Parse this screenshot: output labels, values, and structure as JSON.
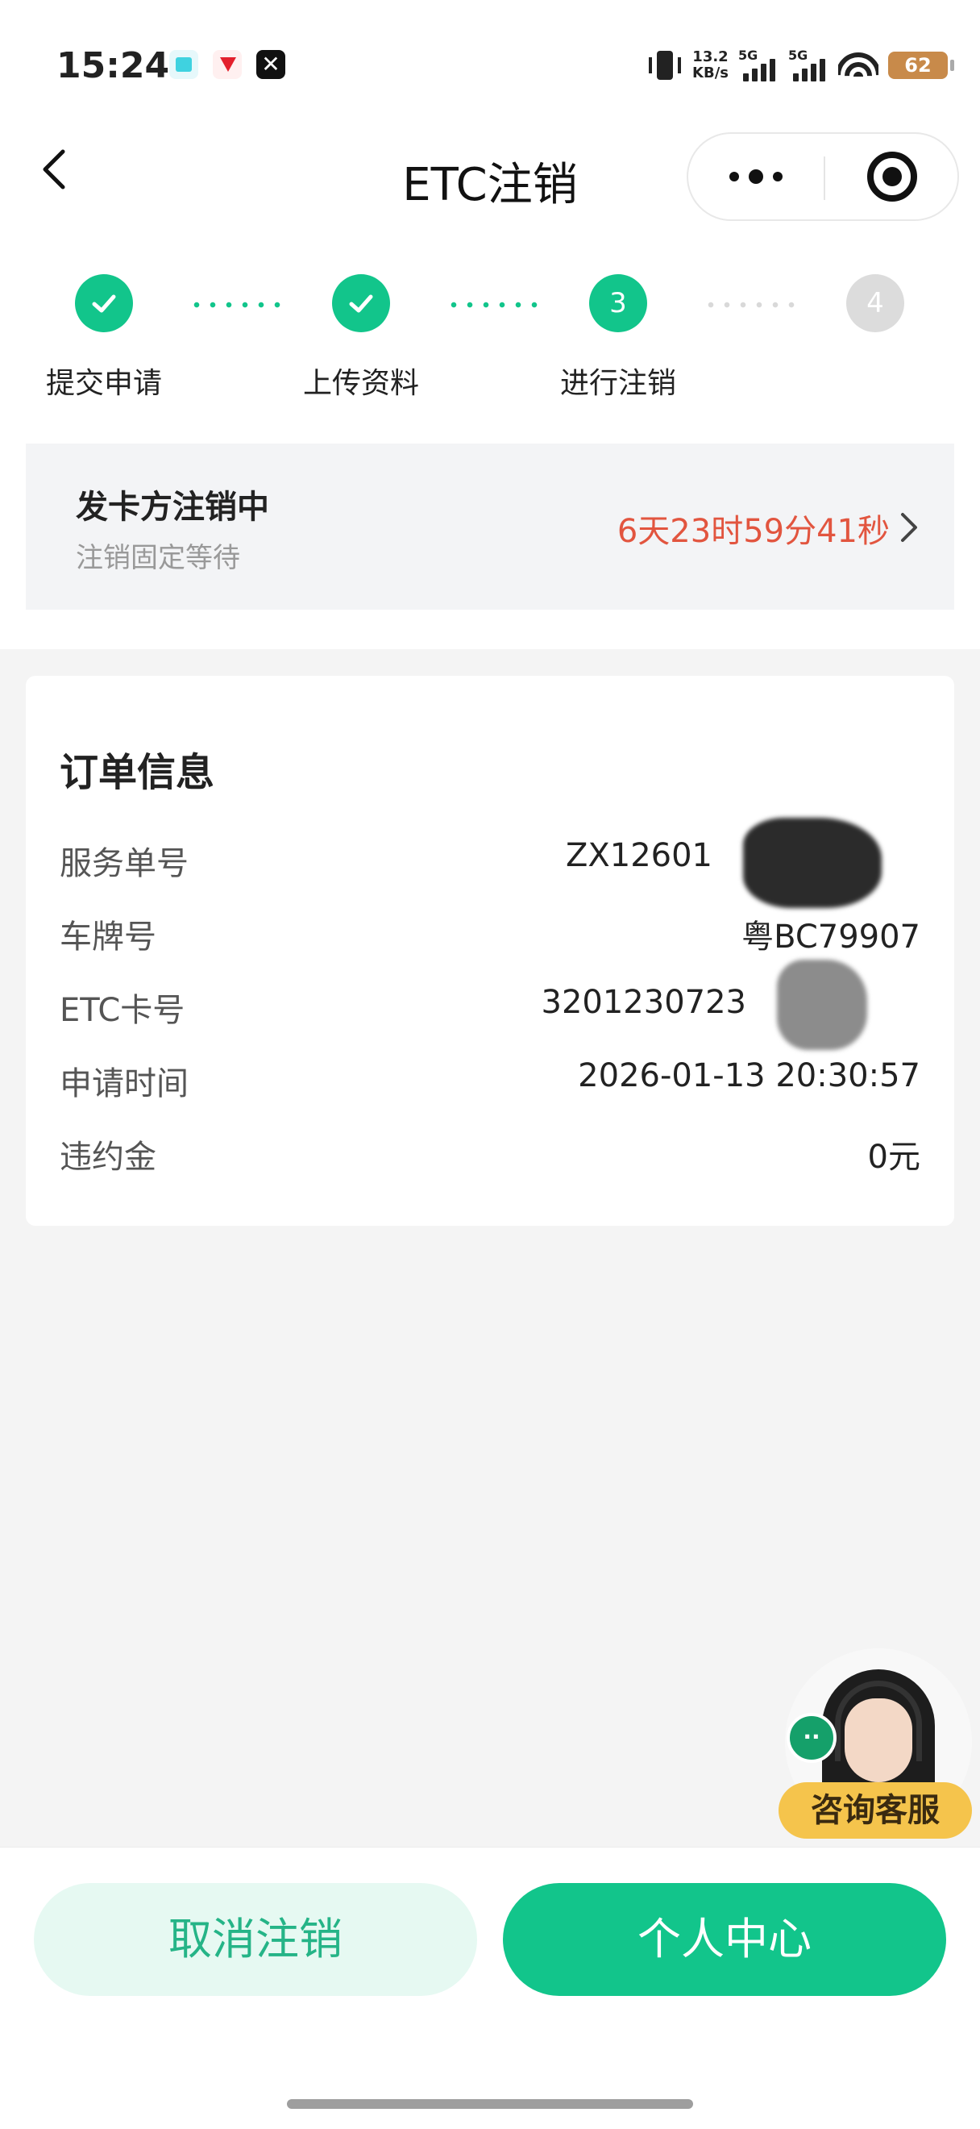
{
  "status_bar": {
    "time": "15:24",
    "net_speed_value": "13.2",
    "net_speed_unit": "KB/s",
    "signal_1_label": "5G",
    "signal_2_label": "5G",
    "battery": "62",
    "icons": [
      "vibrate-icon",
      "signal-icon",
      "wifi-icon",
      "battery-icon"
    ]
  },
  "nav": {
    "title": "ETC注销",
    "back_icon": "chevron-left-icon",
    "more_icon": "more-dots-icon",
    "close_icon": "target-close-icon"
  },
  "steps": [
    {
      "label": "提交申请",
      "state": "done"
    },
    {
      "label": "上传资料",
      "state": "done"
    },
    {
      "label": "进行注销",
      "state": "active",
      "number": "3"
    },
    {
      "label": "",
      "state": "pending",
      "number": "4"
    }
  ],
  "status_card": {
    "title": "发卡方注销中",
    "subtitle": "注销固定等待",
    "countdown": "6天23时59分41秒"
  },
  "order": {
    "title": "订单信息",
    "rows": [
      {
        "key": "服务单号",
        "value": "ZX12601"
      },
      {
        "key": "车牌号",
        "value": "粤BC79907"
      },
      {
        "key": "ETC卡号",
        "value": "3201230723"
      },
      {
        "key": "申请时间",
        "value": "2026-01-13 20:30:57"
      },
      {
        "key": "违约金",
        "value": "0元"
      }
    ]
  },
  "customer_service": {
    "label": "咨询客服"
  },
  "actions": {
    "cancel": "取消注销",
    "personal_center": "个人中心"
  },
  "colors": {
    "accent": "#12c58b",
    "countdown": "#e2553f",
    "cancel_bg": "#e6f9f2"
  }
}
